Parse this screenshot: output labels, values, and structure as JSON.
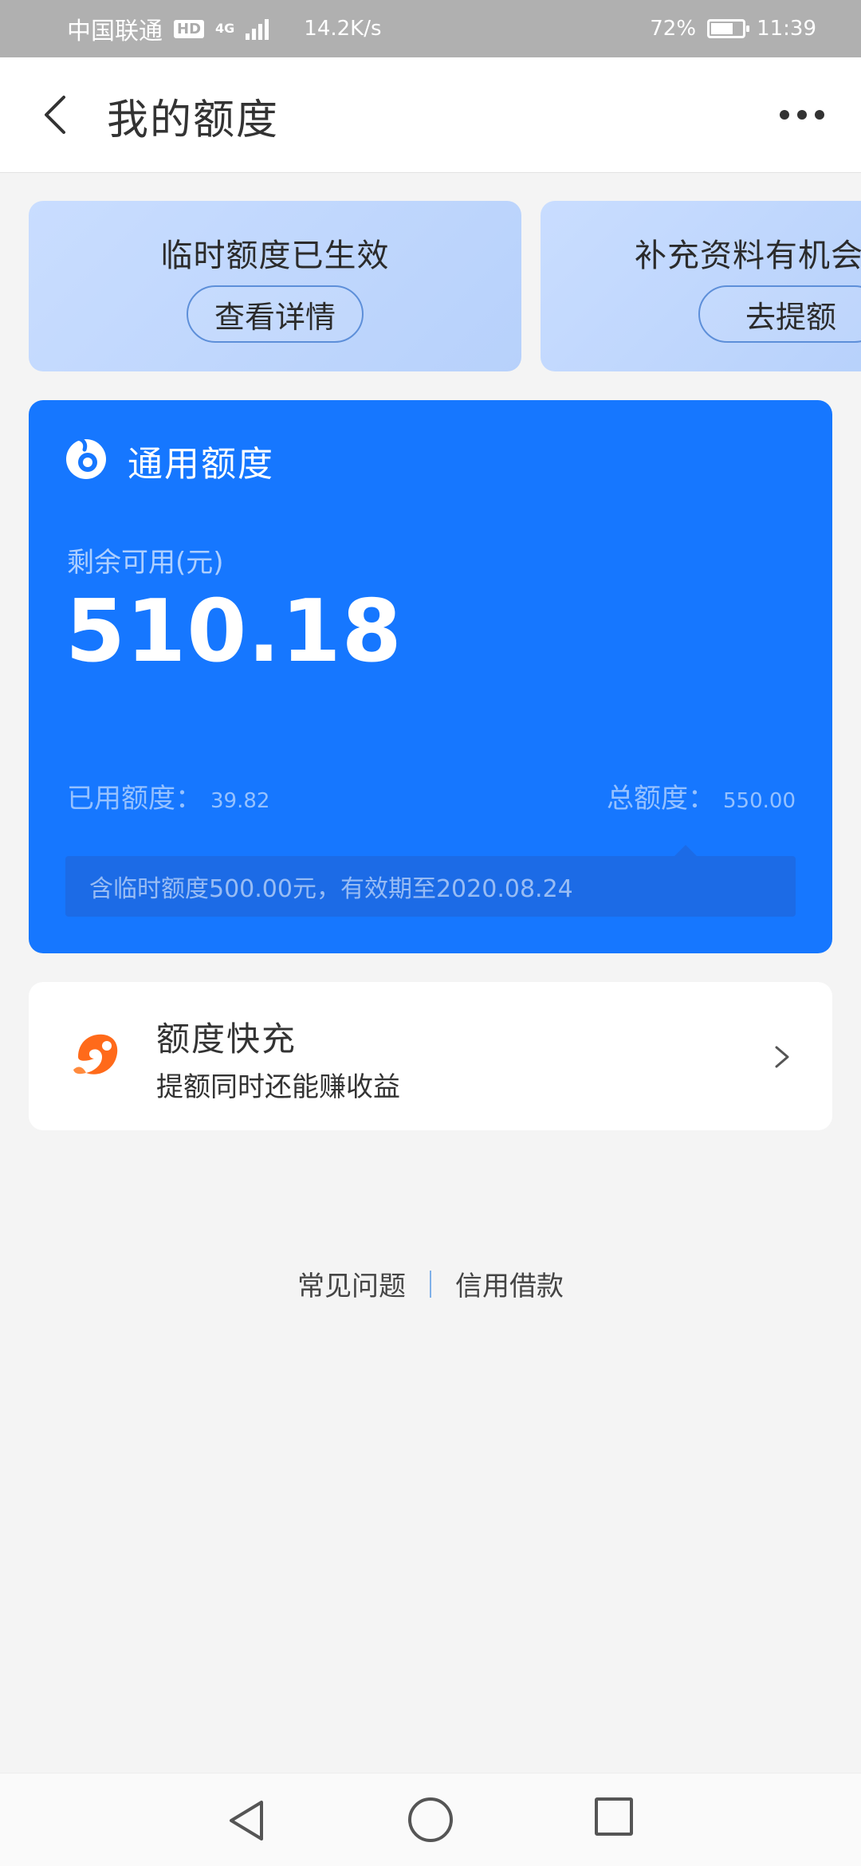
{
  "status_bar": {
    "carrier": "中国联通",
    "hd_badge": "HD",
    "network": "4G",
    "speed": "14.2K/s",
    "battery_percent": "72%",
    "battery_level": 0.72,
    "time": "11:39"
  },
  "header": {
    "title": "我的额度",
    "back_icon": "chevron-left-icon",
    "more_icon": "more-horizontal-icon"
  },
  "promos": [
    {
      "text": "临时额度已生效",
      "button": "查看详情"
    },
    {
      "text": "补充资料有机会",
      "button": "去提额"
    }
  ],
  "quota": {
    "title": "通用额度",
    "remaining_label": "剩余可用(元)",
    "remaining_value": "510.18",
    "used_label": "已用额度：",
    "used_value": "39.82",
    "total_label": "总额度：",
    "total_value": "550.00",
    "notice": "含临时额度500.00元，有效期至2020.08.24"
  },
  "quick_boost": {
    "title": "额度快充",
    "subtitle": "提额同时还能赚收益",
    "icon": "orange-rocket-icon"
  },
  "footer_links": [
    "常见问题",
    "信用借款"
  ],
  "colors": {
    "primary_blue": "#1677ff",
    "promo_blue": "#c4daff",
    "background": "#f4f4f4",
    "orange": "#ff6a1a"
  }
}
